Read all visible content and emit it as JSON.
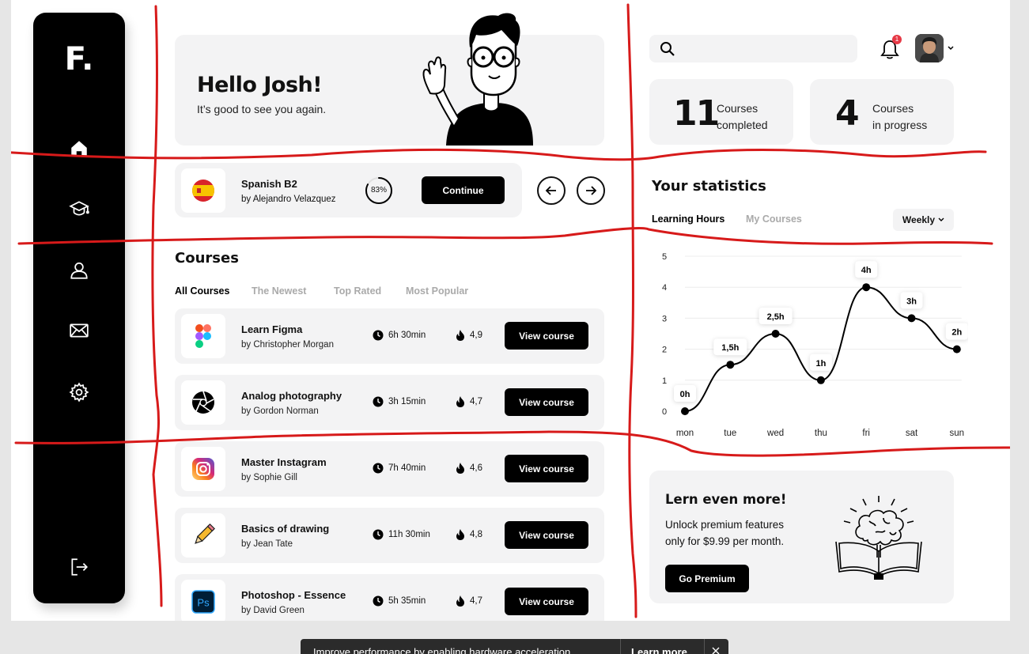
{
  "sidebar": {
    "logo": "F.",
    "items": [
      {
        "name": "home",
        "icon": "home-icon"
      },
      {
        "name": "courses",
        "icon": "graduation-cap-icon"
      },
      {
        "name": "profile",
        "icon": "user-icon"
      },
      {
        "name": "messages",
        "icon": "mail-icon"
      },
      {
        "name": "settings",
        "icon": "gear-icon"
      }
    ],
    "logout_icon": "logout-icon"
  },
  "greeting": {
    "title": "Hello Josh!",
    "subtitle": "It’s good to see you again."
  },
  "current_course": {
    "title": "Spanish B2",
    "author": "by Alejandro Velazquez",
    "progress_label": "83%",
    "progress": 0.83,
    "button": "Continue"
  },
  "courses": {
    "title": "Courses",
    "tabs": [
      "All Courses",
      "The Newest",
      "Top Rated",
      "Most Popular"
    ],
    "active_tab": 0,
    "items": [
      {
        "title": "Learn Figma",
        "author": "by Christopher Morgan",
        "duration": "6h 30min",
        "rating": "4,9",
        "button": "View course",
        "icon": "figma-icon"
      },
      {
        "title": "Analog photography",
        "author": "by Gordon Norman",
        "duration": "3h 15min",
        "rating": "4,7",
        "button": "View course",
        "icon": "camera-aperture-icon"
      },
      {
        "title": "Master Instagram",
        "author": "by Sophie Gill",
        "duration": "7h 40min",
        "rating": "4,6",
        "button": "View course",
        "icon": "instagram-icon"
      },
      {
        "title": "Basics of drawing",
        "author": "by Jean Tate",
        "duration": "11h 30min",
        "rating": "4,8",
        "button": "View course",
        "icon": "pencil-icon"
      },
      {
        "title": "Photoshop - Essence",
        "author": "by David Green",
        "duration": "5h 35min",
        "rating": "4,7",
        "button": "View course",
        "icon": "photoshop-icon"
      }
    ]
  },
  "header": {
    "search_placeholder": "",
    "notification_count": "1"
  },
  "stats_cards": [
    {
      "number": "11",
      "label_line1": "Courses",
      "label_line2": "completed"
    },
    {
      "number": "4",
      "label_line1": "Courses",
      "label_line2": "in progress"
    }
  ],
  "statistics": {
    "title": "Your statistics",
    "tabs": [
      "Learning Hours",
      "My Courses"
    ],
    "active_tab": 0,
    "period": "Weekly"
  },
  "chart_data": {
    "type": "line",
    "title": "",
    "x": [
      "mon",
      "tue",
      "wed",
      "thu",
      "fri",
      "sat",
      "sun"
    ],
    "series": [
      {
        "values": [
          0,
          1.5,
          2.5,
          1,
          4,
          3,
          2
        ]
      }
    ],
    "data_labels": [
      "0h",
      "1,5h",
      "2,5h",
      "1h",
      "4h",
      "3h",
      "2h"
    ],
    "yticks": [
      "0",
      "1",
      "2",
      "3",
      "4",
      "5"
    ],
    "ylim": [
      0,
      5
    ],
    "grid": true,
    "xlabel": "",
    "ylabel": "",
    "colors": {
      "line": "#000000"
    }
  },
  "premium": {
    "title": "Lern even more!",
    "line1": "Unlock premium features",
    "line2": "only for $9.99 per month.",
    "button": "Go Premium"
  },
  "toast": {
    "message": "Improve performance by enabling hardware acceleration",
    "action": "Learn more"
  },
  "colors": {
    "accent": "#000000",
    "panel": "#f3f3f4",
    "annotation": "#d71a1a",
    "badge": "#e63946"
  }
}
